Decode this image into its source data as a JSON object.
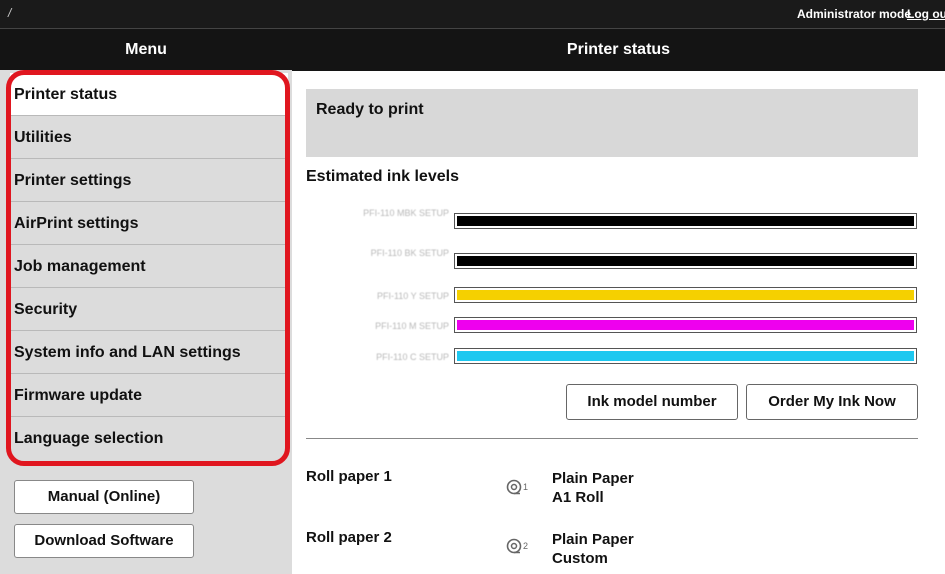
{
  "topbar": {
    "crumb": "/",
    "mode": "Administrator mode",
    "logout": "Log out"
  },
  "header": {
    "menu_title": "Menu",
    "page_title": "Printer status"
  },
  "sidebar": {
    "items": [
      {
        "label": "Printer status",
        "active": true
      },
      {
        "label": "Utilities"
      },
      {
        "label": "Printer settings"
      },
      {
        "label": "AirPrint settings"
      },
      {
        "label": "Job management"
      },
      {
        "label": "Security"
      },
      {
        "label": "System info and LAN settings"
      },
      {
        "label": "Firmware update"
      },
      {
        "label": "Language selection"
      }
    ],
    "manual_button": "Manual (Online)",
    "download_button": "Download Software",
    "highlight_color": "#e0161f"
  },
  "main": {
    "status_text": "Ready to print",
    "ink_title": "Estimated ink levels",
    "inks": [
      {
        "label": "PFI-110 MBK SETUP",
        "color": "#000000",
        "level": 1.0
      },
      {
        "label": "PFI-110 BK SETUP",
        "color": "#000000",
        "level": 1.0
      },
      {
        "label": "PFI-110 Y SETUP",
        "color": "#f5d000",
        "level": 1.0
      },
      {
        "label": "PFI-110 M SETUP",
        "color": "#ee00ee",
        "level": 1.0
      },
      {
        "label": "PFI-110 C SETUP",
        "color": "#1ec8f0",
        "level": 1.0
      }
    ],
    "ink_model_button": "Ink model number",
    "order_ink_button": "Order My Ink Now",
    "rolls": [
      {
        "label": "Roll paper 1",
        "icon": "roll-1-icon",
        "icon_num": "1",
        "media": "Plain Paper",
        "size": "A1 Roll"
      },
      {
        "label": "Roll paper 2",
        "icon": "roll-2-icon",
        "icon_num": "2",
        "media": "Plain Paper",
        "size": "Custom"
      }
    ]
  }
}
